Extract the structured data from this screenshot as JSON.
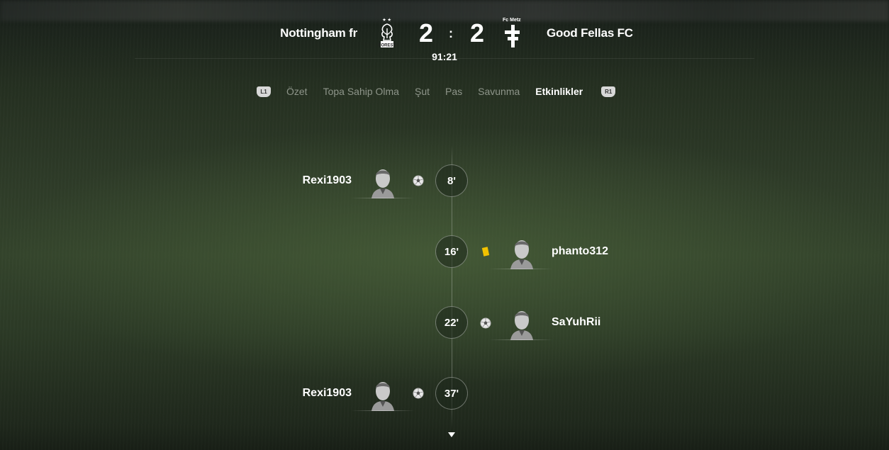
{
  "match": {
    "home_team": "Nottingham fr",
    "away_team": "Good Fellas  FC",
    "home_score": "2",
    "away_score": "2",
    "separator": ":",
    "clock": "91:21",
    "away_crest_label": "Fc Metz",
    "home_crest_label": "FOREST"
  },
  "tabs": {
    "left_button": "L1",
    "right_button": "R1",
    "items": [
      {
        "label": "Özet"
      },
      {
        "label": "Topa Sahip Olma"
      },
      {
        "label": "Şut"
      },
      {
        "label": "Pas"
      },
      {
        "label": "Savunma"
      },
      {
        "label": "Etkinlikler"
      }
    ],
    "active": "Etkinlikler"
  },
  "events": [
    {
      "minute": "8'",
      "player": "Rexi1903",
      "side": "home",
      "type": "goal-icon"
    },
    {
      "minute": "16'",
      "player": "phanto312",
      "side": "away",
      "type": "yellow-card-icon"
    },
    {
      "minute": "22'",
      "player": "SaYuhRii",
      "side": "away",
      "type": "goal-icon"
    },
    {
      "minute": "37'",
      "player": "Rexi1903",
      "side": "home",
      "type": "goal-icon"
    }
  ],
  "colors": {
    "active_tab": "#ffffff",
    "inactive_tab": "#8e958a",
    "yellow_card": "#f2c200"
  }
}
